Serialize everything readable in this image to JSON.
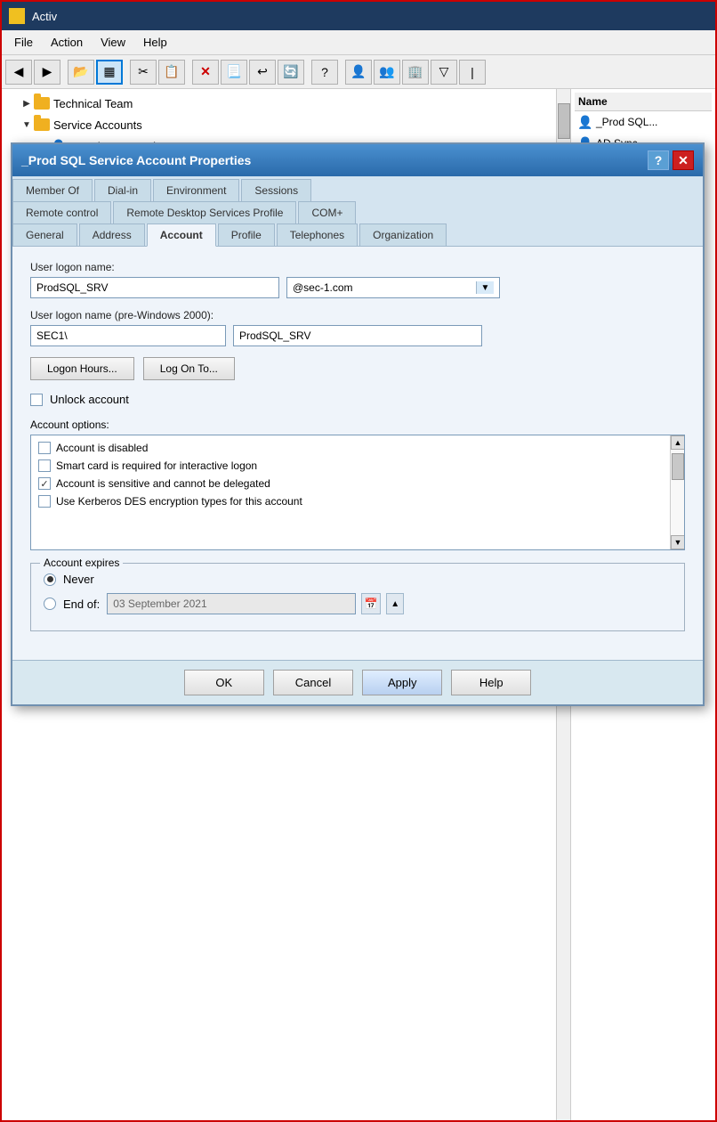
{
  "titlebar": {
    "icon": "■",
    "title": "Activ"
  },
  "menubar": {
    "items": [
      "File",
      "Action",
      "View",
      "Help"
    ]
  },
  "toolbar": {
    "buttons": [
      {
        "name": "back-btn",
        "icon": "◀",
        "label": "Back"
      },
      {
        "name": "forward-btn",
        "icon": "▶",
        "label": "Forward"
      },
      {
        "name": "up-btn",
        "icon": "⬆",
        "label": "Up"
      },
      {
        "name": "refresh-btn",
        "icon": "⟳",
        "label": "Refresh"
      },
      {
        "name": "delete-btn",
        "icon": "✕",
        "label": "Delete"
      },
      {
        "name": "properties-btn",
        "icon": "📋",
        "label": "Properties"
      },
      {
        "name": "help-btn",
        "icon": "?",
        "label": "Help"
      }
    ]
  },
  "tree": {
    "items": [
      {
        "label": "Technical Team",
        "level": 1,
        "type": "folder",
        "expanded": false
      },
      {
        "label": "Service Accounts",
        "level": 1,
        "type": "folder",
        "expanded": true
      },
      {
        "label": "_Prod SQL Service Account",
        "level": 2,
        "type": "user",
        "expanded": false
      }
    ]
  },
  "right_panel": {
    "header": "Name",
    "items": [
      {
        "label": "_Prod SQL...",
        "type": "user"
      },
      {
        "label": "AD Sync",
        "type": "user"
      }
    ]
  },
  "dialog": {
    "title": "_Prod SQL Service Account Properties",
    "help_label": "?",
    "close_label": "✕",
    "tabs_row1": [
      {
        "label": "Member Of",
        "active": false
      },
      {
        "label": "Dial-in",
        "active": false
      },
      {
        "label": "Environment",
        "active": false
      },
      {
        "label": "Sessions",
        "active": false
      }
    ],
    "tabs_row2": [
      {
        "label": "Remote control",
        "active": false
      },
      {
        "label": "Remote Desktop Services Profile",
        "active": false
      },
      {
        "label": "COM+",
        "active": false
      }
    ],
    "tabs_row3": [
      {
        "label": "General",
        "active": false
      },
      {
        "label": "Address",
        "active": false
      },
      {
        "label": "Account",
        "active": true
      },
      {
        "label": "Profile",
        "active": false
      },
      {
        "label": "Telephones",
        "active": false
      },
      {
        "label": "Organization",
        "active": false
      }
    ],
    "body": {
      "logon_name_label": "User logon name:",
      "logon_name_value": "ProdSQL_SRV",
      "domain_options": [
        "@sec-1.com"
      ],
      "domain_selected": "@sec-1.com",
      "pre2000_label": "User logon name (pre-Windows 2000):",
      "pre2000_prefix": "SEC1\\",
      "pre2000_suffix": "ProdSQL_SRV",
      "btn_logon_hours": "Logon Hours...",
      "btn_log_on_to": "Log On To...",
      "unlock_label": "Unlock account",
      "unlock_checked": false,
      "account_options_label": "Account options:",
      "options": [
        {
          "label": "Account is disabled",
          "checked": false
        },
        {
          "label": "Smart card is required for interactive logon",
          "checked": false
        },
        {
          "label": "Account is sensitive and cannot be delegated",
          "checked": true
        },
        {
          "label": "Use Kerberos DES encryption types for this account",
          "checked": false
        }
      ],
      "expires_group_label": "Account expires",
      "never_label": "Never",
      "never_selected": true,
      "end_of_label": "End of:",
      "end_of_selected": false,
      "date_placeholder": "03 September 2021"
    },
    "footer": {
      "ok_label": "OK",
      "cancel_label": "Cancel",
      "apply_label": "Apply",
      "help_label": "Help"
    }
  }
}
